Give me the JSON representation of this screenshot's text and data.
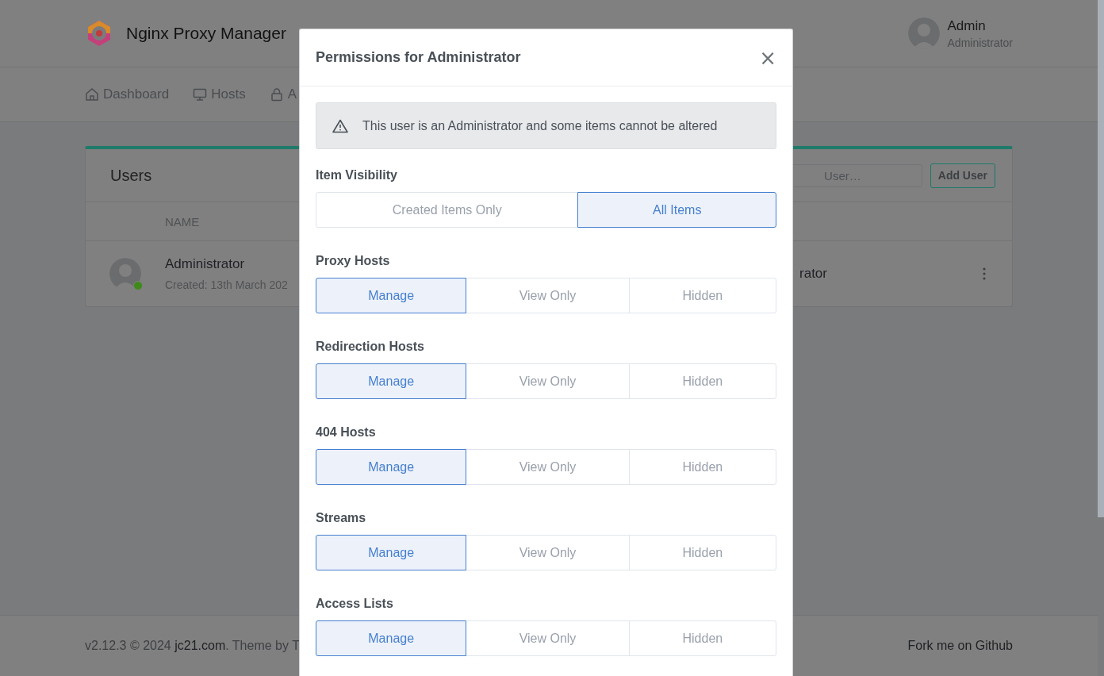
{
  "app": {
    "title": "Nginx Proxy Manager"
  },
  "user_menu": {
    "name": "Admin",
    "role": "Administrator"
  },
  "nav": [
    {
      "label": "Dashboard"
    },
    {
      "label": "Hosts"
    },
    {
      "label": "A"
    }
  ],
  "users_card": {
    "title": "Users",
    "search": {
      "placeholder": "User…"
    },
    "add_button": "Add User",
    "columns": [
      "NAME"
    ],
    "rows": [
      {
        "name": "Administrator",
        "created": "Created: 13th March 202",
        "role": "rator",
        "online": true
      }
    ]
  },
  "footer": {
    "text_before": "v2.12.3 © 2024 ",
    "link": "jc21.com",
    "text_after": ". Theme by T",
    "right_link": "Fork me on Github"
  },
  "modal": {
    "title": "Permissions for Administrator",
    "close": "×",
    "alert": "This user is an Administrator and some items cannot be altered",
    "sections": [
      {
        "label": "Item Visibility",
        "options": [
          {
            "label": "Created Items Only",
            "selected": false
          },
          {
            "label": "All Items",
            "selected": true
          }
        ]
      },
      {
        "label": "Proxy Hosts",
        "options": [
          {
            "label": "Manage",
            "selected": true
          },
          {
            "label": "View Only",
            "selected": false
          },
          {
            "label": "Hidden",
            "selected": false
          }
        ]
      },
      {
        "label": "Redirection Hosts",
        "options": [
          {
            "label": "Manage",
            "selected": true
          },
          {
            "label": "View Only",
            "selected": false
          },
          {
            "label": "Hidden",
            "selected": false
          }
        ]
      },
      {
        "label": "404 Hosts",
        "options": [
          {
            "label": "Manage",
            "selected": true
          },
          {
            "label": "View Only",
            "selected": false
          },
          {
            "label": "Hidden",
            "selected": false
          }
        ]
      },
      {
        "label": "Streams",
        "options": [
          {
            "label": "Manage",
            "selected": true
          },
          {
            "label": "View Only",
            "selected": false
          },
          {
            "label": "Hidden",
            "selected": false
          }
        ]
      },
      {
        "label": "Access Lists",
        "options": [
          {
            "label": "Manage",
            "selected": true
          },
          {
            "label": "View Only",
            "selected": false
          },
          {
            "label": "Hidden",
            "selected": false
          }
        ]
      }
    ]
  }
}
